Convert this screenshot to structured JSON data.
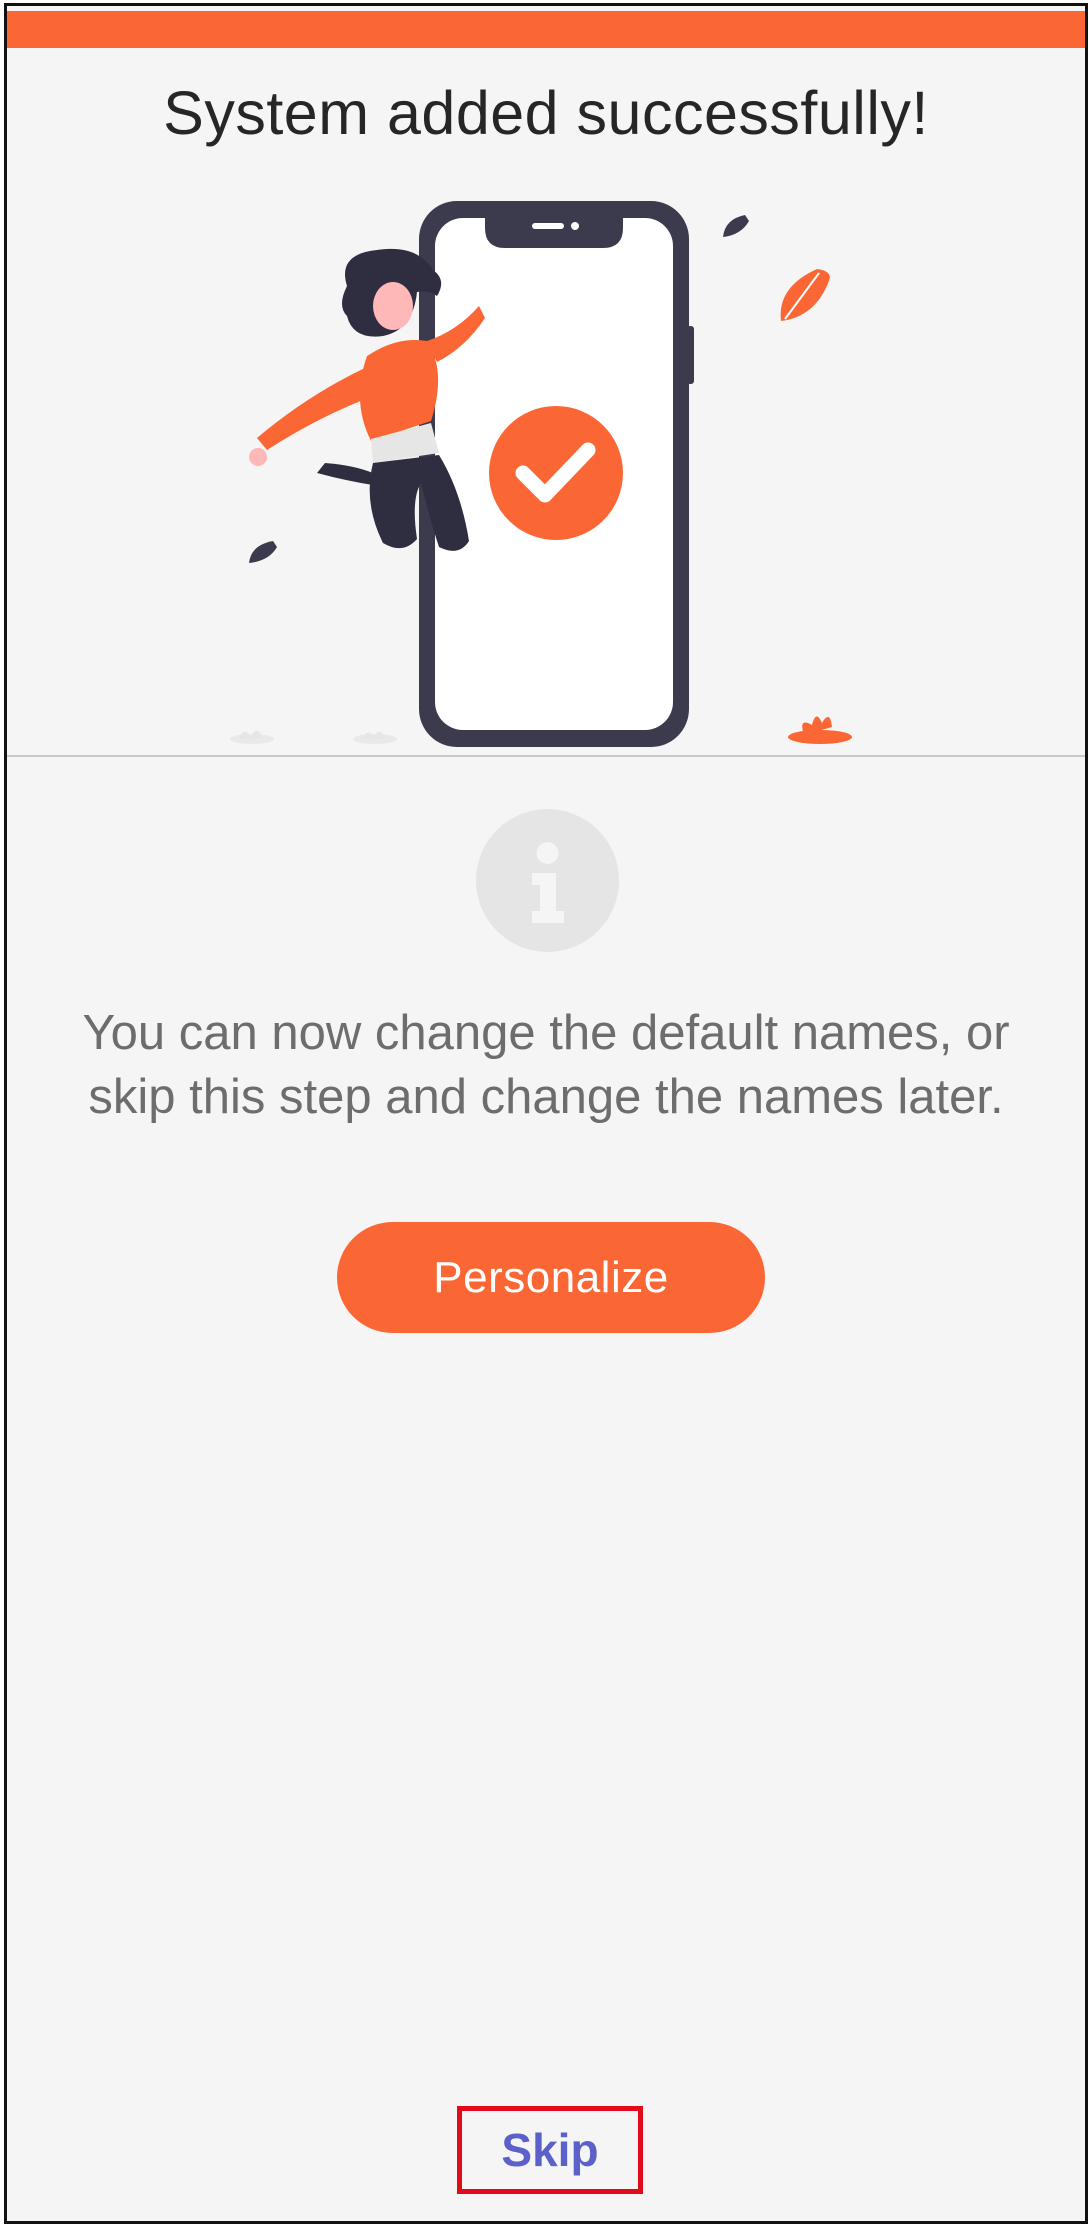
{
  "header": {
    "accent_color": "#fb6734",
    "title": "System added successfully!"
  },
  "illustration": {
    "description_icon": "success-phone-illustration",
    "check_icon": "checkmark-icon"
  },
  "info": {
    "icon": "info-icon",
    "message_line1": "You can now change the default names, or",
    "message_line2": "skip this step and change the names later."
  },
  "actions": {
    "personalize_label": "Personalize",
    "skip_label": "Skip",
    "skip_color": "#5b61c8",
    "highlight_color": "#e30b1b"
  }
}
